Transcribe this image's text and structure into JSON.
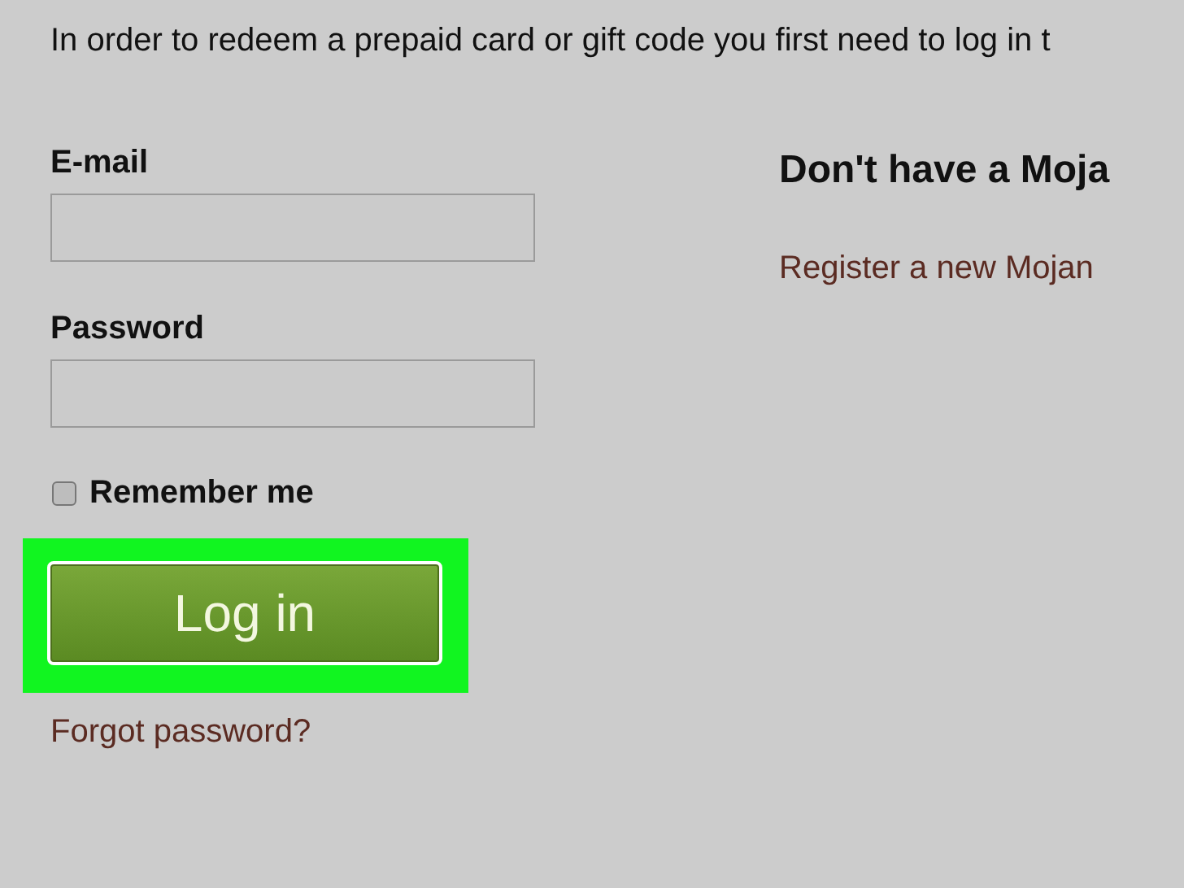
{
  "intro": "In order to redeem a prepaid card or gift code you first need to log in t",
  "login": {
    "email_label": "E-mail",
    "password_label": "Password",
    "remember": {
      "label": "Remember me",
      "checked": false
    },
    "button": {
      "label": "Log in",
      "highlighted": true
    },
    "forgot": "Forgot password?"
  },
  "register": {
    "heading": "Don't have a Moja",
    "link": "Register a new Mojan"
  }
}
